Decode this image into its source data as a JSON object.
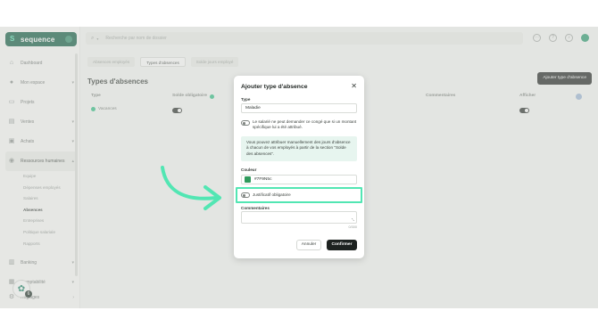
{
  "app": {
    "brand": "sequence",
    "search_placeholder": "Recherche par nom de dossier",
    "accent": "#0f5c42",
    "highlight": "#52e6b3"
  },
  "sidebar": {
    "items": [
      {
        "label": "Dashboard",
        "icon": "home-icon"
      },
      {
        "label": "Mon espace",
        "icon": "user-icon"
      },
      {
        "label": "Projets",
        "icon": "folder-icon"
      },
      {
        "label": "Ventes",
        "icon": "chart-icon"
      },
      {
        "label": "Achats",
        "icon": "cart-icon"
      },
      {
        "label": "Ressources humaines",
        "icon": "people-icon"
      }
    ],
    "sub_items": [
      "Equipe",
      "Dépenses employés",
      "Salaires",
      "Absences",
      "Entreprises",
      "Politique salariale",
      "Rapports"
    ],
    "current_sub": "Absences",
    "bottom_items": [
      {
        "label": "Banking",
        "icon": "bank-icon"
      },
      {
        "label": "Comptabilité",
        "icon": "ledger-icon"
      },
      {
        "label": "Réglages",
        "icon": "settings-icon"
      }
    ],
    "help_badge": "6"
  },
  "main": {
    "tabs": [
      "Absences employés",
      "Types d'absences",
      "Solde jours employé"
    ],
    "active_tab": "Types d'absences",
    "title": "Types d'absences",
    "add_button": "Ajouter type d'absence",
    "columns": [
      "Type",
      "Solde obligatoire",
      "Commentaires",
      "Afficher"
    ],
    "rows": [
      {
        "type": "Vacances"
      }
    ]
  },
  "modal": {
    "title": "Ajouter type d'absence",
    "type_label": "Type",
    "type_value": "Maladie",
    "fixed_amount_text": "Le salarié ne peut demander ce congé que si un montant spécifique lui a été attribué.",
    "notice": "Vous pouvez attribuer manuellement des jours d'absence à chacun de vos employés à partir de la section \"Solde des absences\".",
    "color_label": "Couleur",
    "color_value": "#7F9N5c",
    "justificatif_text": "Justificatif obligatoire",
    "comments_label": "Commentaires",
    "counter": "0/300",
    "cancel": "Annuler",
    "confirm": "Confirmer"
  }
}
